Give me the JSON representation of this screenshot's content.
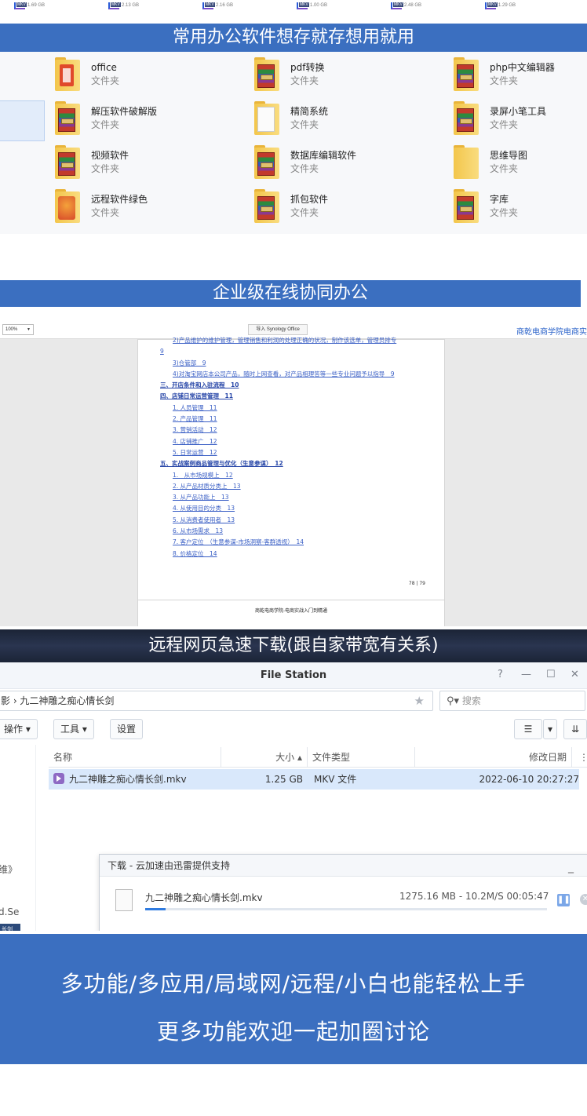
{
  "top_strip": {
    "videos": [
      {
        "badge": "MKV",
        "size": "1.69 GB"
      },
      {
        "badge": "MKV",
        "size": "2.13 GB"
      },
      {
        "badge": "MKV",
        "size": "2.16 GB"
      },
      {
        "badge": "MKV",
        "size": "1.00 GB"
      },
      {
        "badge": "MKV",
        "size": "2.48 GB"
      },
      {
        "badge": "MKV",
        "size": "1.29 GB"
      }
    ]
  },
  "sections": {
    "s1": "常用办公软件想存就存想用就用",
    "s2": "企业级在线协同办公",
    "s3": "远程网页急速下载(跟自家带宽有关系)"
  },
  "folders": [
    {
      "name": "office",
      "type": "文件夹",
      "icon": "office-folder-icon"
    },
    {
      "name": "pdf转换",
      "type": "文件夹",
      "icon": "winrar-folder-icon"
    },
    {
      "name": "php中文编辑器",
      "type": "文件夹",
      "icon": "winrar-folder-icon"
    },
    {
      "name": "解压软件破解版",
      "type": "文件夹",
      "icon": "winrar-folder-icon"
    },
    {
      "name": "精简系统",
      "type": "文件夹",
      "icon": "document-folder-icon"
    },
    {
      "name": "录屏小笔工具",
      "type": "文件夹",
      "icon": "winrar-folder-icon"
    },
    {
      "name": "视频软件",
      "type": "文件夹",
      "icon": "winrar-folder-icon"
    },
    {
      "name": "数据库编辑软件",
      "type": "文件夹",
      "icon": "winrar-folder-icon"
    },
    {
      "name": "思维导图",
      "type": "文件夹",
      "icon": "folder-icon"
    },
    {
      "name": "远程软件绿色",
      "type": "文件夹",
      "icon": "remote-folder-icon"
    },
    {
      "name": "抓包软件",
      "type": "文件夹",
      "icon": "winrar-folder-icon"
    },
    {
      "name": "字库",
      "type": "文件夹",
      "icon": "winrar-folder-icon"
    }
  ],
  "office": {
    "zoom": "100%",
    "import_label": "导入 Synology Office",
    "doc_title": "商乾电商学院电商实",
    "toc": [
      {
        "text": "2)产品维护的维护管理，管理销售和利润的处理正确的状况，制作该选单，管理员排专",
        "level": "i2",
        "cut": true
      },
      {
        "text": "9",
        "level": "i1"
      },
      {
        "text": "3)仓管部　9",
        "level": "i2"
      },
      {
        "text": "4)对淘宝网店本公司产品，随时上网查看，对产品相理答等一些专业问题予以指导　9",
        "level": "i2"
      },
      {
        "text": "三、开店条件和入驻流程　10",
        "level": "h"
      },
      {
        "text": "四、店铺日常运营管理　11",
        "level": "h"
      },
      {
        "text": "1. 人员管理　11",
        "level": "i2"
      },
      {
        "text": "2. 产品管理　11",
        "level": "i2"
      },
      {
        "text": "3. 营销活动　12",
        "level": "i2"
      },
      {
        "text": "4. 店铺推广　12",
        "level": "i2"
      },
      {
        "text": "5. 日常运营　12",
        "level": "i2"
      },
      {
        "text": "五、实战案例商品管理与优化（生意参谋）　12",
        "level": "h"
      },
      {
        "text": "1.　从市场规模上　12",
        "level": "i2"
      },
      {
        "text": "2. 从产品材质分类上　13",
        "level": "i2"
      },
      {
        "text": "3. 从产品功能上　13",
        "level": "i2"
      },
      {
        "text": "4. 从使用目的分类　13",
        "level": "i2"
      },
      {
        "text": "5. 从消费者使用者　13",
        "level": "i2"
      },
      {
        "text": "6. 从市场需求　13",
        "level": "i2"
      },
      {
        "text": "7. 客户定位　（生意参谋-市场洞察-客群透视）　14",
        "level": "i2"
      },
      {
        "text": "8. 价格定位　14",
        "level": "i2"
      }
    ],
    "page_num": "78 | 79",
    "next_page_header": "商乾电商学院-电商实战入门到精通"
  },
  "file_station": {
    "title": "File Station",
    "path": "影 › 九二神雕之痴心情长剑",
    "search_placeholder": "搜索",
    "buttons": {
      "action": "操作 ▾",
      "tools": "工具 ▾",
      "settings": "设置"
    },
    "columns": {
      "name": "名称",
      "size": "大小 ▴",
      "type": "文件类型",
      "modified": "修改日期"
    },
    "rows": [
      {
        "name": "九二神雕之痴心情长剑.mkv",
        "size": "1.25 GB",
        "type": "MKV 文件",
        "modified": "2022-06-10 20:27:27"
      }
    ],
    "sidebar_fragments": [
      "维》",
      "d.Se"
    ],
    "sidebar_selected": "长剑"
  },
  "download": {
    "title": "下载 - 云加速由迅雷提供支持",
    "file": "九二神雕之痴心情长剑.mkv",
    "stats": "1275.16 MB - 10.2M/S 00:05:47",
    "progress": 0.05
  },
  "footer": {
    "line1": "多功能/多应用/局域网/远程/小白也能轻松上手",
    "line2": "更多功能欢迎一起加圈讨论"
  },
  "colors": {
    "brand_blue": "#3b6fc0",
    "link_blue": "#3a5fc5",
    "selection": "#d9e8fb"
  }
}
